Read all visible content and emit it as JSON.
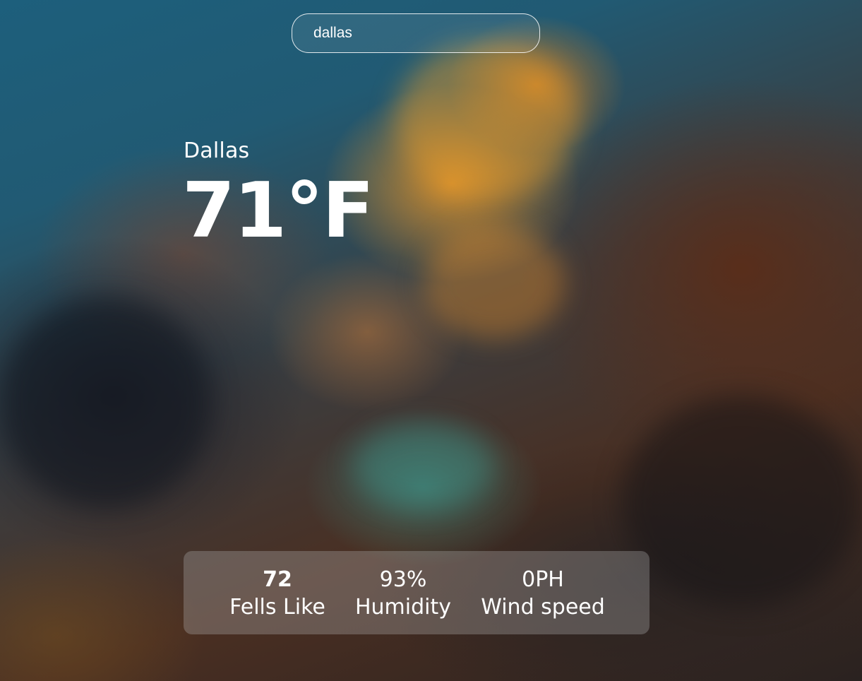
{
  "search": {
    "value": "dallas"
  },
  "location": {
    "city": "Dallas"
  },
  "current": {
    "temperature": "71°F"
  },
  "details": {
    "feels_like": {
      "value": "72",
      "label": "Fells Like"
    },
    "humidity": {
      "value": "93%",
      "label": "Humidity"
    },
    "wind_speed": {
      "value": "0PH",
      "label": "Wind speed"
    }
  }
}
